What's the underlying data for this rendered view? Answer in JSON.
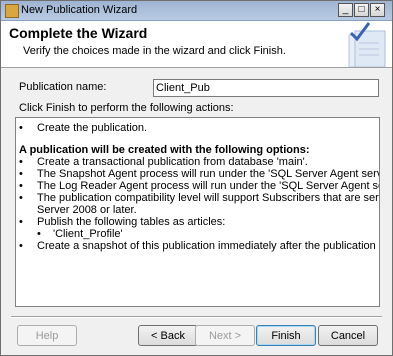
{
  "window": {
    "title": "New Publication Wizard",
    "controls": {
      "minimize": "_",
      "maximize": "□",
      "close": "×"
    }
  },
  "header": {
    "title": "Complete the Wizard",
    "subtitle": "Verify the choices made in the wizard and click Finish."
  },
  "form": {
    "publication_label": "Publication name:",
    "publication_value": "Client_Pub",
    "instructions": "Click Finish to perform the following actions:"
  },
  "actions": {
    "create": "Create the publication.",
    "options_heading": "A publication will be created with the following options:",
    "items": [
      "Create a transactional publication from database 'main'.",
      "The Snapshot Agent process will run under the 'SQL Server Agent service' account.",
      "The Log Reader Agent process will run under the 'SQL Server Agent service' account.",
      "The publication compatibility level will support Subscribers that are servers running SQL",
      "Server 2008 or later.",
      "Publish the following tables as articles:",
      "'Client_Profile'",
      "Create a snapshot of this publication immediately after the publication is created."
    ]
  },
  "buttons": {
    "help": "Help",
    "back": "< Back",
    "next": "Next >",
    "finish": "Finish",
    "cancel": "Cancel"
  },
  "colors": {
    "titlebar": "#b9cbe3",
    "window_bg": "#f0f0f0",
    "default_button_border": "#3c7fb1"
  }
}
